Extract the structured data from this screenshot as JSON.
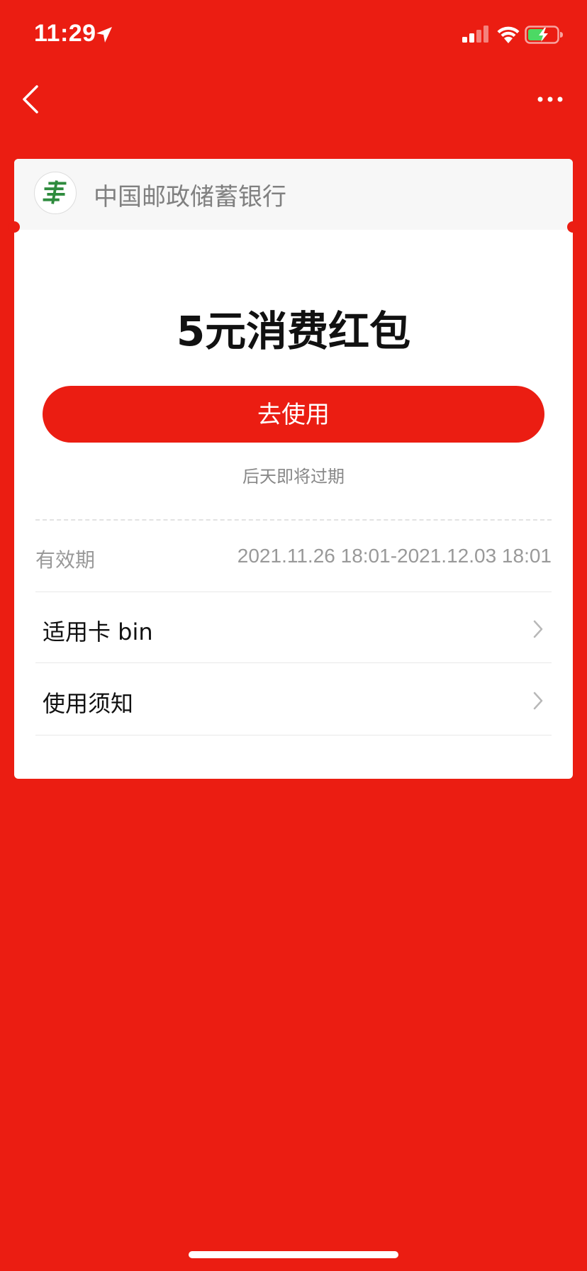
{
  "status_bar": {
    "time": "11:29",
    "icons": [
      "location-arrow-icon",
      "signal-icon",
      "wifi-icon",
      "battery-charging-icon"
    ]
  },
  "nav": {
    "icons": [
      "back-icon",
      "more-icon"
    ]
  },
  "card": {
    "bank_name": "中国邮政储蓄银行",
    "bank_logo_icon": "postal-savings-bank-logo",
    "title": "5元消费红包",
    "use_button": "去使用",
    "expire_hint": "后天即将过期",
    "validity_label": "有效期",
    "validity_value": "2021.11.26 18:01-2021.12.03 18:01",
    "rows": [
      {
        "label": "适用卡 bin"
      },
      {
        "label": "使用须知"
      }
    ]
  },
  "colors": {
    "background": "#EB1D12",
    "card": "#FFFFFF",
    "header": "#F7F7F7",
    "logo_green": "#2E8B3D"
  }
}
